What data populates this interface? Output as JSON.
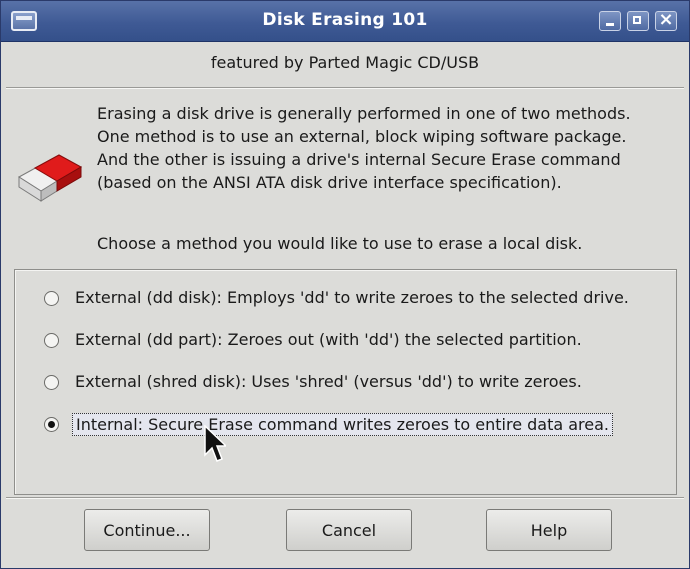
{
  "window": {
    "title": "Disk Erasing 101"
  },
  "header": {
    "subtitle": "featured by Parted Magic CD/USB"
  },
  "body": {
    "icon": "eraser-icon",
    "description": "Erasing a disk drive is generally performed in one of two methods.\nOne method is to use an external, block wiping software package.\nAnd the other is issuing a drive's internal Secure Erase command\n(based on the ANSI ATA disk drive interface specification).",
    "prompt": "Choose a method you would like to use to erase a local disk."
  },
  "options": [
    {
      "label": "External (dd disk): Employs 'dd' to write zeroes to the selected drive.",
      "selected": false
    },
    {
      "label": "External (dd part): Zeroes out (with 'dd') the selected partition.",
      "selected": false
    },
    {
      "label": "External (shred disk): Uses 'shred' (versus 'dd') to write zeroes.",
      "selected": false
    },
    {
      "label": "Internal: Secure Erase command writes zeroes to entire data area.",
      "selected": true
    }
  ],
  "buttons": {
    "continue": "Continue...",
    "cancel": "Cancel",
    "help": "Help"
  },
  "colors": {
    "titlebar": "#4a649c",
    "dialog_background": "#dcdcd9",
    "eraser_red": "#d91a1a"
  }
}
